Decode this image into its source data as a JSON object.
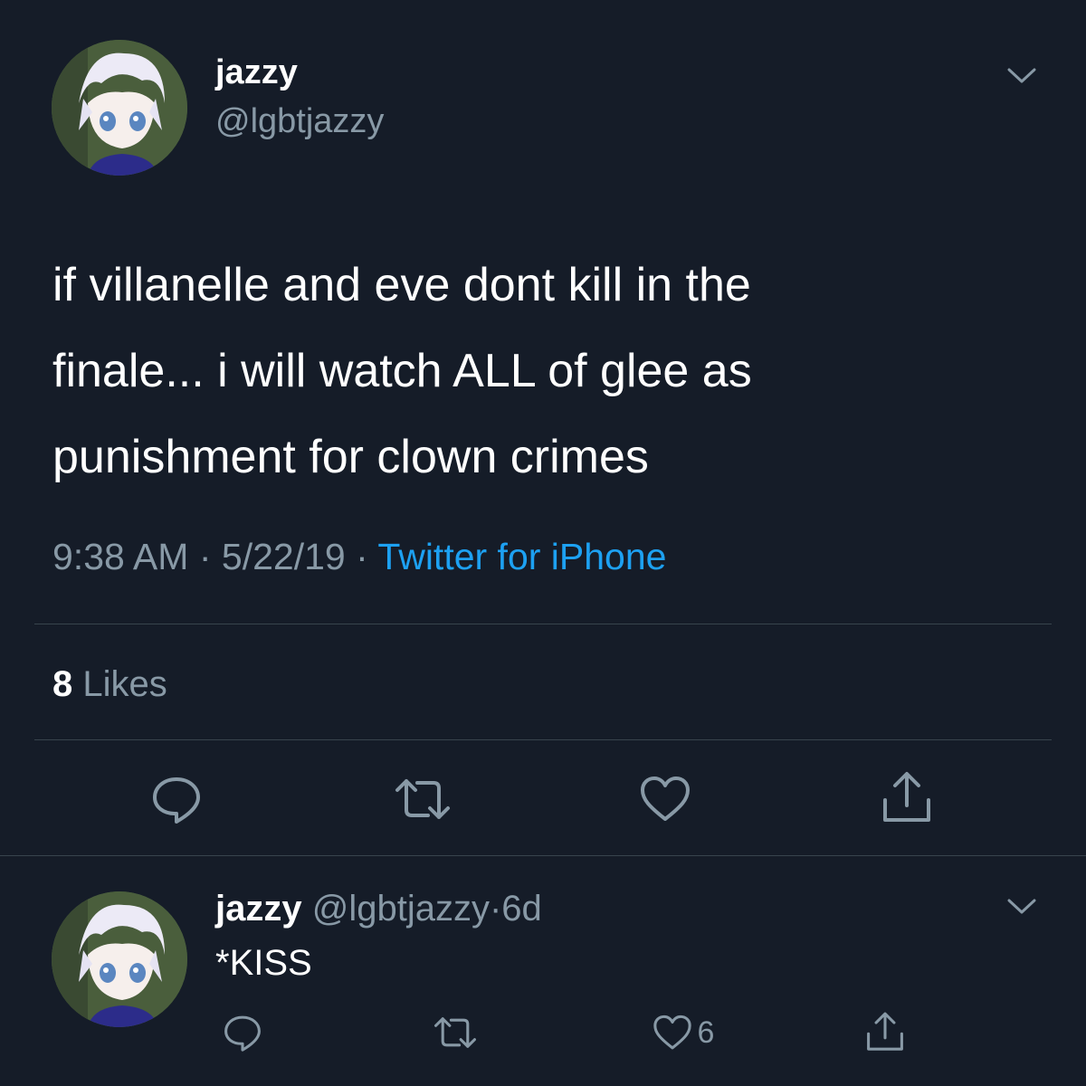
{
  "tweet": {
    "display_name": "jazzy",
    "handle": "@lgbtjazzy",
    "text_lines": [
      "if villanelle and eve dont kill in the",
      "finale... i will watch ALL of glee as",
      "punishment for clown crimes"
    ],
    "time": "9:38 AM",
    "sep1": "·",
    "date": "5/22/19",
    "sep2": "·",
    "source": "Twitter for iPhone",
    "likes_count": "8",
    "likes_label": "Likes"
  },
  "reply": {
    "display_name": "jazzy",
    "handle": "@lgbtjazzy",
    "sep": "·",
    "age": "6d",
    "text": "*KISS",
    "like_count": "6"
  },
  "icons": {
    "caret": "chevron-down-icon",
    "reply": "reply-bubble-icon",
    "retweet": "retweet-icon",
    "like": "heart-icon",
    "share": "share-icon",
    "avatar": "anime-avatar-image"
  },
  "colors": {
    "background": "#151c28",
    "text": "#ffffff",
    "muted": "#8899a6",
    "link": "#1da1f2",
    "divider": "#38444d"
  }
}
